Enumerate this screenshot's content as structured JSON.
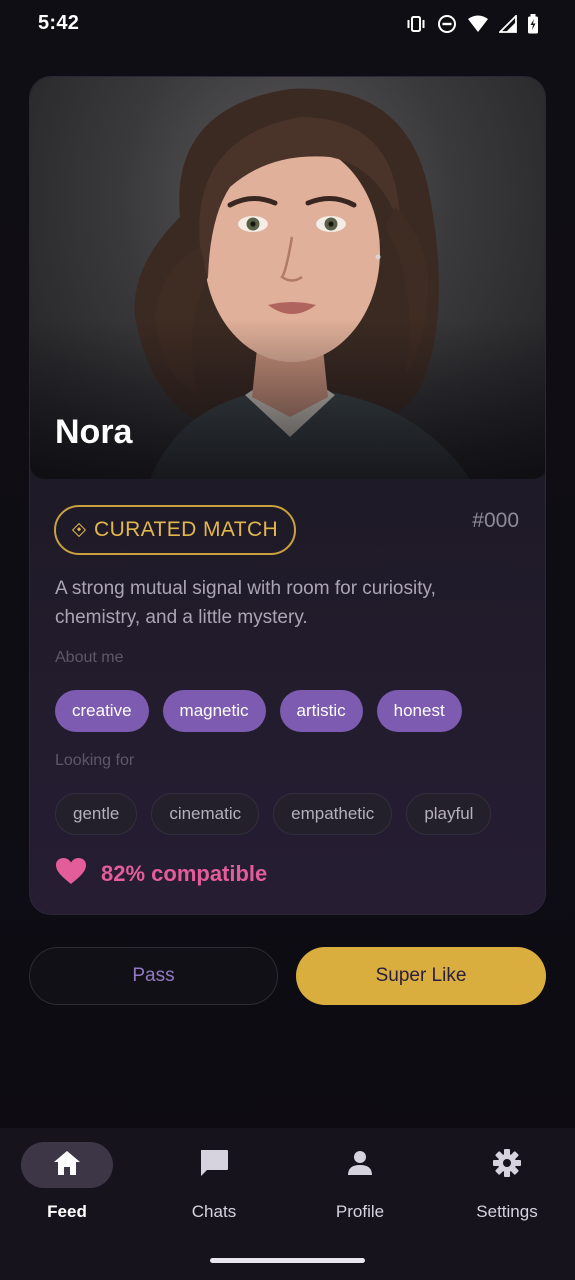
{
  "status_bar": {
    "time": "5:42"
  },
  "profile": {
    "name": "Nora",
    "badge": "CURATED MATCH",
    "match_id": "#000",
    "tagline": "A strong mutual signal with room for curiosity, chemistry, and a little mystery.",
    "about_label": "About me",
    "about_tags": [
      "creative",
      "magnetic",
      "artistic",
      "honest"
    ],
    "looking_label": "Looking for",
    "looking_tags": [
      "gentle",
      "cinematic",
      "empathetic",
      "playful"
    ],
    "compatibility": "82% compatible"
  },
  "actions": {
    "pass_label": "Pass",
    "super_like_label": "Super Like"
  },
  "nav": {
    "items": [
      {
        "label": "Feed",
        "icon": "home-icon",
        "active": true
      },
      {
        "label": "Chats",
        "icon": "chat-icon",
        "active": false
      },
      {
        "label": "Profile",
        "icon": "person-icon",
        "active": false
      },
      {
        "label": "Settings",
        "icon": "gear-icon",
        "active": false
      }
    ]
  },
  "colors": {
    "accent_gold": "#d9ad3e",
    "accent_purple": "#7c5bb0",
    "compat_pink": "#e35d9a",
    "background": "#0f0d14"
  }
}
